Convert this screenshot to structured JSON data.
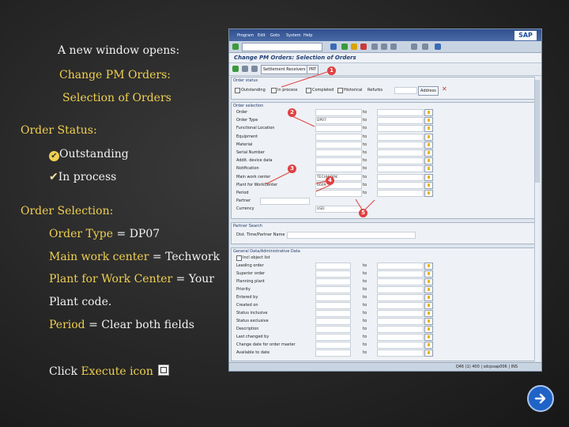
{
  "slide": {
    "intro": "A new window opens:",
    "heading_line1": "Change PM Orders:",
    "heading_line2": "Selection of Orders",
    "order_status_title": "Order Status:",
    "status_items": [
      {
        "label": "Outstanding",
        "icon": "checked-circle-icon"
      },
      {
        "label": "In process",
        "icon": "check-mark-icon"
      }
    ],
    "order_selection_title": "Order Selection:",
    "selection_items": [
      {
        "field": "Order Type",
        "sep": " = ",
        "value": "DP07"
      },
      {
        "field": "Main work center",
        "sep": " = ",
        "value": "Techwork"
      },
      {
        "field": "Plant for Work Center",
        "sep": " = ",
        "value": "Your"
      },
      {
        "field": "",
        "sep": "",
        "value": "Plant code."
      },
      {
        "field": "Period",
        "sep": " = ",
        "value": "Clear both fields"
      }
    ],
    "click_prefix": "Click ",
    "click_target": "Execute icon"
  },
  "sap": {
    "logo": "SAP",
    "menu": [
      "Program",
      "Edit",
      "Goto",
      "System",
      "Help"
    ],
    "title": "Change PM Orders: Selection of Orders",
    "app_buttons": [
      "Settlement Receivers",
      "PRT"
    ],
    "order_status_header": "Order status",
    "status_options": [
      "Outstanding",
      "In process",
      "Completed",
      "Historical",
      "Refurbs"
    ],
    "address_button": "Address",
    "order_selection_header": "Order selection",
    "selection_rows": [
      {
        "label": "Order",
        "value": ""
      },
      {
        "label": "Order Type",
        "value": "DP07"
      },
      {
        "label": "Functional Location",
        "value": ""
      },
      {
        "label": "Equipment",
        "value": ""
      },
      {
        "label": "Material",
        "value": ""
      },
      {
        "label": "Serial Number",
        "value": ""
      },
      {
        "label": "Addit. device data",
        "value": ""
      },
      {
        "label": "Notification",
        "value": ""
      },
      {
        "label": "Main work center",
        "value": "TECHWORK"
      },
      {
        "label": "Plant for WorkCenter",
        "value": "6009"
      },
      {
        "label": "Period",
        "value": ""
      },
      {
        "label": "Partner",
        "value": ""
      },
      {
        "label": "Currency",
        "value": "USD"
      }
    ],
    "to_label": "to",
    "partner_header": "Partner Search",
    "partner_label": "Dist. Time/Partner Name",
    "general_header": "General Data/Administrative Data",
    "general_rows": [
      "Incl object list",
      "Leading order",
      "Superior order",
      "Planning plant",
      "Priority",
      "Entered by",
      "Created on",
      "Status inclusive",
      "Status exclusive",
      "Description",
      "Last changed by",
      "Change date for order master",
      "Available to date"
    ],
    "markers": [
      "1",
      "2",
      "3",
      "4",
      "5"
    ],
    "status_text": "Q46 (1) 400 | sdcpsap006 | INS"
  },
  "colors": {
    "accent_yellow": "#f0d050",
    "text_white": "#f2f2f2",
    "marker_red": "#e04040",
    "next_blue": "#1f63c6"
  }
}
